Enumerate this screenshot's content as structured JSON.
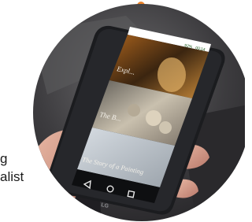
{
  "page": {
    "left_text_line1": "g",
    "left_text_line2": "alist"
  },
  "phone": {
    "brand_logo": "LG",
    "status_time": "00:14",
    "status_battery": "92%",
    "articles": [
      {
        "title": "Expl..."
      },
      {
        "title": "The B..."
      },
      {
        "title": "The Story of a Painting"
      }
    ],
    "nav_icons": [
      "back-icon",
      "home-icon",
      "recent-apps-icon"
    ]
  },
  "colors": {
    "accent_dot": "#e8822a",
    "scene_dark": "#2b2b2e",
    "phone_body": "#1b1c1f"
  }
}
